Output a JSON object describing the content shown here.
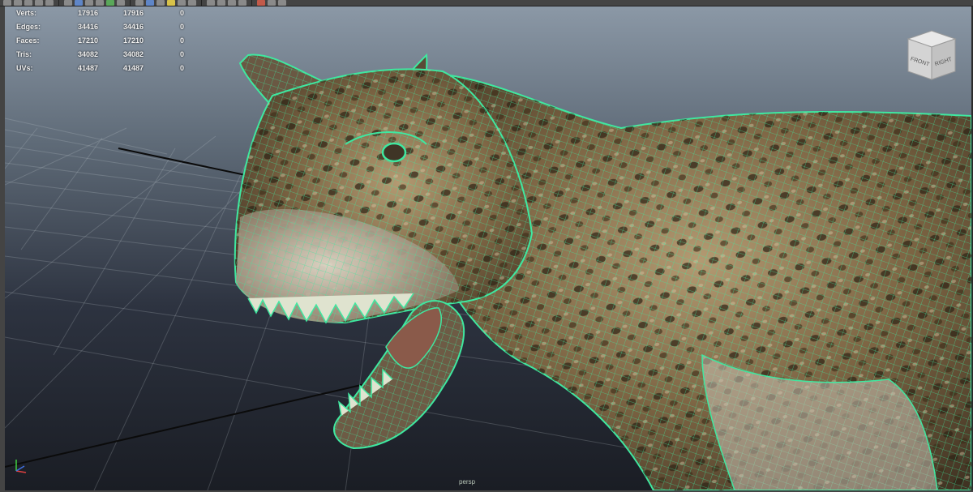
{
  "hud": {
    "rows": [
      {
        "label": "Verts:",
        "v1": "17916",
        "v2": "17916",
        "v3": "0"
      },
      {
        "label": "Edges:",
        "v1": "34416",
        "v2": "34416",
        "v3": "0"
      },
      {
        "label": "Faces:",
        "v1": "17210",
        "v2": "17210",
        "v3": "0"
      },
      {
        "label": "Tris:",
        "v1": "34082",
        "v2": "34082",
        "v3": "0"
      },
      {
        "label": "UVs:",
        "v1": "41487",
        "v2": "41487",
        "v3": "0"
      }
    ]
  },
  "viewcube": {
    "front_label": "FRONT",
    "right_label": "RIGHT"
  },
  "viewport": {
    "camera_label": "persp"
  },
  "icons": {
    "toolbar": "shelf-tool-icons",
    "viewcube": "viewcube-icon",
    "axis": "axis-gizmo-icon"
  },
  "colors": {
    "wireframe": "#3fe8a0",
    "grid": "#d8dde4",
    "axis_x": "#e04040",
    "axis_y": "#40d040",
    "axis_z": "#4070e0"
  }
}
